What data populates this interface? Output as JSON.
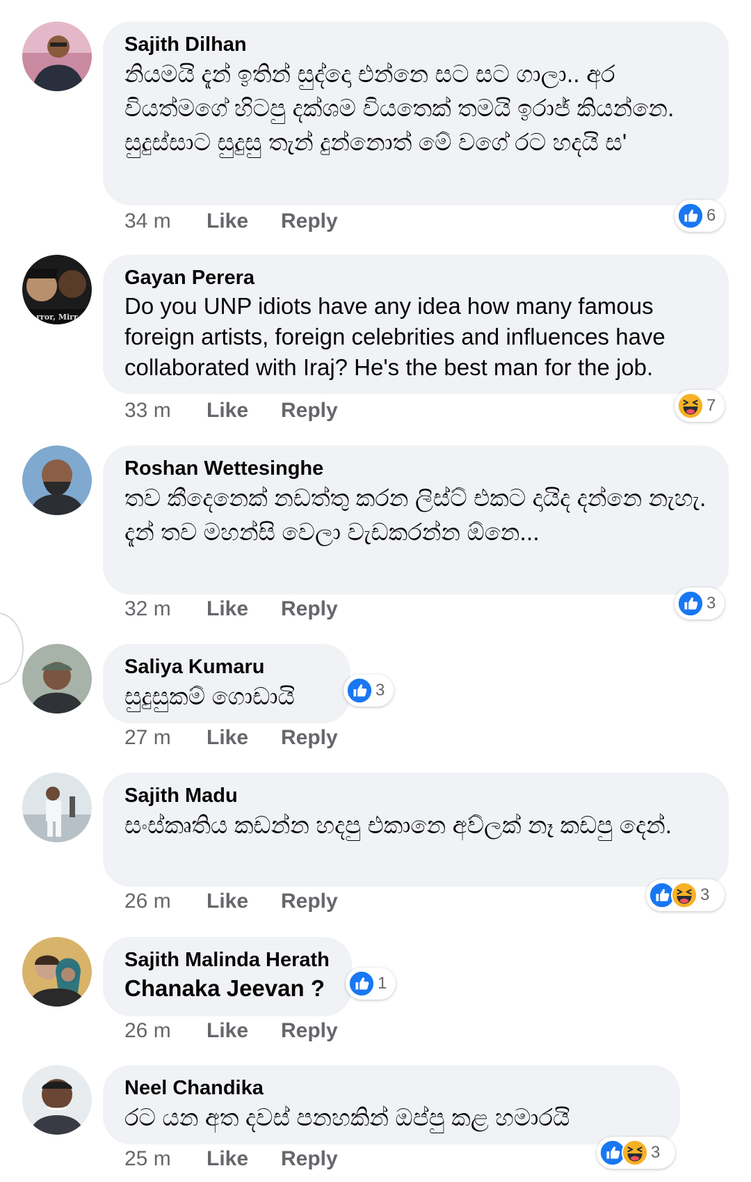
{
  "actions": {
    "like_label": "Like",
    "reply_label": "Reply"
  },
  "colors": {
    "like_blue": "#1877f2",
    "haha_yellow": "#f7b125",
    "bubble_bg": "#f0f2f5",
    "meta_gray": "#65676b"
  },
  "comments": [
    {
      "author": "Sajith Dilhan",
      "text": "නියමයි දැන් ඉතින් සුද්දො එන්නෙ සට සට ගාලා.. අර වියත්මගේ හිටපු දක්ශම වියතෙක් තමයි ඉරාජ් කියන්නෙ. සුදුස්සාට සුදුසු තැන් දුන්නොත් මේ වගේ රට හදයි ස'",
      "time": "34 m",
      "reactions": [
        "like-icon"
      ],
      "reaction_count": "6"
    },
    {
      "author": "Gayan Perera",
      "text": "Do you UNP idiots have any idea how many famous foreign artists, foreign celebrities and influences have collaborated with Iraj? He's the best man for the job.",
      "time": "33 m",
      "reactions": [
        "haha-icon"
      ],
      "reaction_count": "7"
    },
    {
      "author": "Roshan Wettesinghe",
      "text": "තව කීදෙනෙක් නඩත්තු කරන ලිස්ට් එකට දායිද දන්නෙ නැහැ. දැන් තව මහන්සි වෙලා වැඩකරන්න ඕනෙ...",
      "time": "32 m",
      "reactions": [
        "like-icon"
      ],
      "reaction_count": "3"
    },
    {
      "author": "Saliya Kumaru",
      "text": "සුදුසුකම් ගොඩායි",
      "time": "27 m",
      "reactions": [
        "like-icon"
      ],
      "reaction_count": "3"
    },
    {
      "author": "Sajith Madu",
      "text": "සංස්කෘතිය කඩන්න හදපු එකානෙ අව්ලක් නෑ කඩපු දෙන්.",
      "time": "26 m",
      "reactions": [
        "like-icon",
        "haha-icon"
      ],
      "reaction_count": "3"
    },
    {
      "author": "Sajith Malinda Herath",
      "text": "Chanaka Jeevan ?",
      "time": "26 m",
      "reactions": [
        "like-icon"
      ],
      "reaction_count": "1"
    },
    {
      "author": "Neel Chandika",
      "text": "රට යන අත  දවස් පනහකින් ඔප්පු කළ හමාරයි",
      "time": "25 m",
      "reactions": [
        "like-icon",
        "haha-icon"
      ],
      "reaction_count": "3"
    }
  ]
}
